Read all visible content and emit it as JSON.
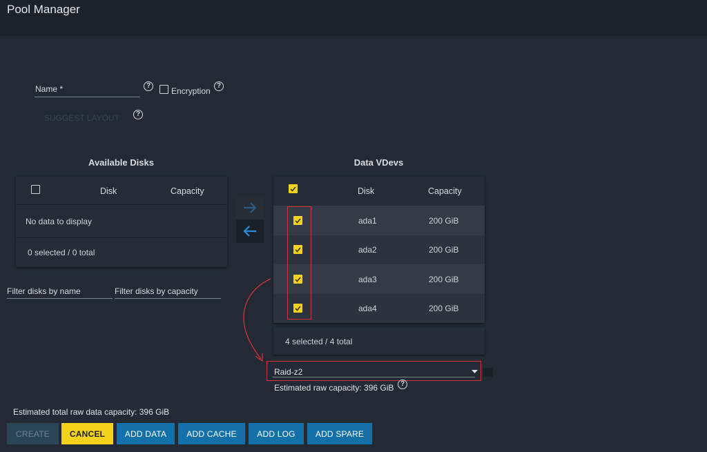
{
  "header": {
    "title": "Pool Manager"
  },
  "form": {
    "name_label": "Name *",
    "help_glyph": "?",
    "encryption_label": "Encryption",
    "suggest_layout_label": "SUGGEST LAYOUT"
  },
  "available_disks": {
    "title": "Available Disks",
    "columns": [
      "Disk",
      "Capacity"
    ],
    "empty_text": "No data to display",
    "footer": "0 selected / 0 total",
    "filter_name_placeholder": "Filter disks by name",
    "filter_capacity_placeholder": "Filter disks by capacity"
  },
  "data_vdevs": {
    "title": "Data VDevs",
    "columns": [
      "Disk",
      "Capacity"
    ],
    "rows": [
      {
        "disk": "ada1",
        "capacity": "200 GiB",
        "checked": true
      },
      {
        "disk": "ada2",
        "capacity": "200 GiB",
        "checked": true
      },
      {
        "disk": "ada3",
        "capacity": "200 GiB",
        "checked": true
      },
      {
        "disk": "ada4",
        "capacity": "200 GiB",
        "checked": true
      }
    ],
    "footer": "4 selected / 4 total",
    "layout_value": "Raid-z2",
    "estimated_raw": "Estimated raw capacity: 396 GiB"
  },
  "summary": {
    "estimated_total": "Estimated total raw data capacity: 396 GiB"
  },
  "actions": {
    "create": "CREATE",
    "cancel": "CANCEL",
    "add_data": "ADD DATA",
    "add_cache": "ADD CACHE",
    "add_log": "ADD LOG",
    "add_spare": "ADD SPARE"
  },
  "colors": {
    "background": "#232a33",
    "accent_yellow": "#f2d21a",
    "button_blue": "#1370a8",
    "annotation_red": "#d8303a"
  },
  "icons": [
    "help-icon",
    "arrow-right-icon",
    "arrow-left-icon",
    "dropdown-caret-icon",
    "checkmark-icon"
  ]
}
